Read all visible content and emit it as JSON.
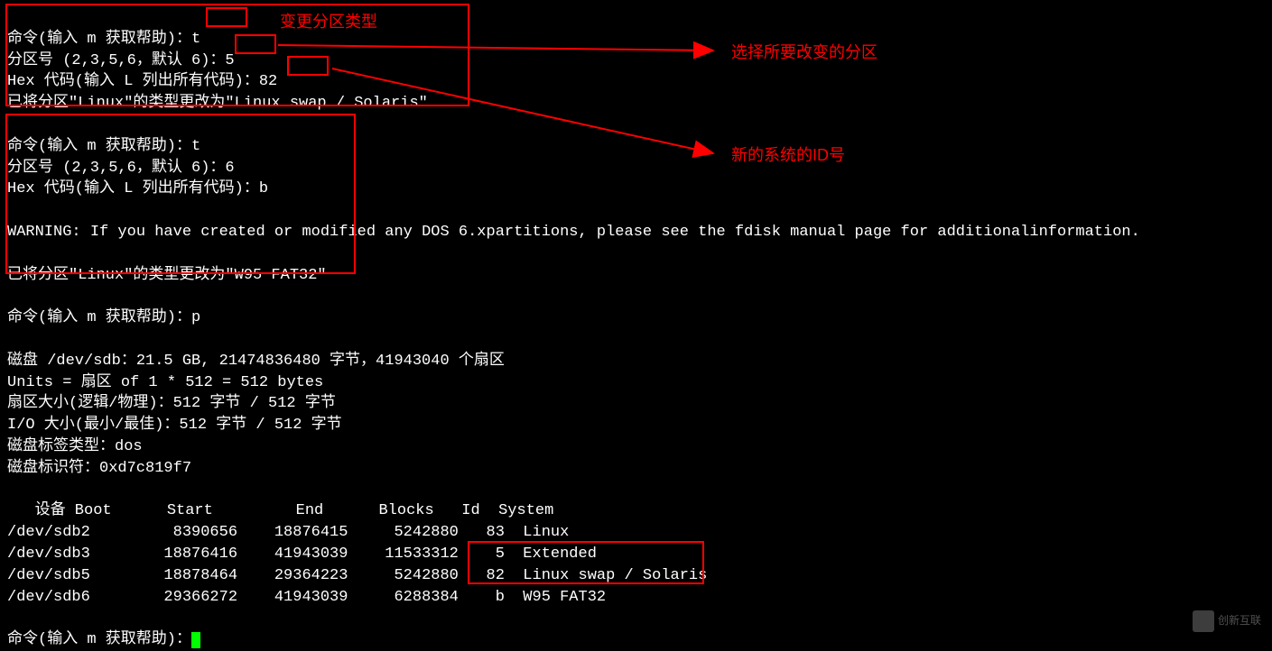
{
  "block1": {
    "l1_prefix": "命令(输入 m 获取帮助)：",
    "l1_val": "t",
    "l2_prefix": "分区号 (2,3,5,6，默认 6)：",
    "l2_val": "5",
    "l3_prefix": "Hex 代码(输入 L 列出所有代码)：",
    "l3_val": "82",
    "l4": "已将分区\"Linux\"的类型更改为\"Linux swap / Solaris\""
  },
  "annotations": {
    "a1": "变更分区类型",
    "a2": "选择所要改变的分区",
    "a3": "新的系统的ID号"
  },
  "block2": {
    "l1": "命令(输入 m 获取帮助)：t",
    "l2": "分区号 (2,3,5,6，默认 6)：6",
    "l3": "Hex 代码(输入 L 列出所有代码)：b",
    "warn": "WARNING: If you have created or modified any DOS 6.xpartitions, please see the fdisk manual page for additionalinformation.",
    "result": "已将分区\"Linux\"的类型更改为\"W95 FAT32\""
  },
  "block3": {
    "l1": "命令(输入 m 获取帮助)：p",
    "disk": "磁盘 /dev/sdb：21.5 GB, 21474836480 字节，41943040 个扇区",
    "units": "Units = 扇区 of 1 * 512 = 512 bytes",
    "sector": "扇区大小(逻辑/物理)：512 字节 / 512 字节",
    "io": "I/O 大小(最小/最佳)：512 字节 / 512 字节",
    "labeltype": "磁盘标签类型：dos",
    "ident": "磁盘标识符：0xd7c819f7"
  },
  "table": {
    "header": "   设备 Boot      Start         End      Blocks   Id  System",
    "rows": [
      "/dev/sdb2         8390656    18876415     5242880   83  Linux",
      "/dev/sdb3        18876416    41943039    11533312    5  Extended",
      "/dev/sdb5        18878464    29364223     5242880   82  Linux swap / Solaris",
      "/dev/sdb6        29366272    41943039     6288384    b  W95 FAT32"
    ]
  },
  "prompt_final": "命令(输入 m 获取帮助)：",
  "watermark": "创新互联"
}
